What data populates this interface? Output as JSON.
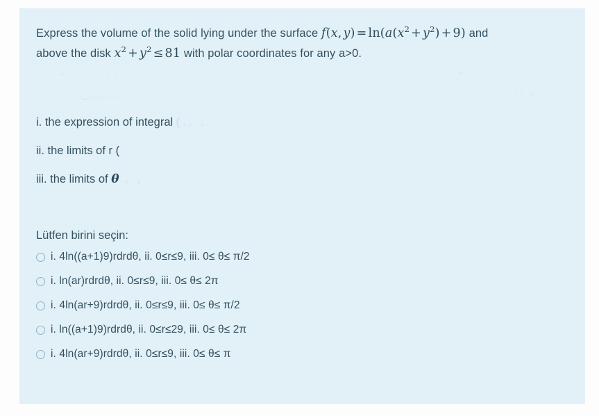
{
  "card": {
    "background_color": "#e2f0f8",
    "page_background_color": "#fdfdfd",
    "text_color": "#33515e"
  },
  "question": {
    "line1_prefix": "Express the volume of the solid lying under  the surface ",
    "formula_surface": "f(x, y) = ln(a(x² + y²) + 9)",
    "line1_suffix": " and",
    "line2_prefix": "above the disk ",
    "formula_disk": "x² + y² ≤ 81",
    "line2_suffix": " with  polar coordinates for any a>0."
  },
  "ghost_text": {
    "g1": ". - . . ..",
    "g2": ". .",
    "g3": "-_...... . ...",
    "g4": "- .",
    "g5": ".. ,"
  },
  "requirements": [
    {
      "label": "i. the expression of integral ",
      "trail": "(.. ."
    },
    {
      "label": "ii. the limits of r (",
      "trail": ""
    },
    {
      "label": "iii. the limits of ",
      "symbol": "θ",
      "trail": " .   ,"
    }
  ],
  "choose_prompt": "Lütfen birini seçin:",
  "options": [
    {
      "id": "a",
      "text": "i. 4ln((a+1)9)rdrdθ, ii. 0≤r≤9, iii. 0≤ θ≤ π/2",
      "selected": false
    },
    {
      "id": "b",
      "text": "i. ln(ar)rdrdθ, ii. 0≤r≤9, iii. 0≤ θ≤ 2π",
      "selected": false
    },
    {
      "id": "c",
      "text": "i. 4ln(ar+9)rdrdθ, ii. 0≤r≤9, iii. 0≤ θ≤ π/2",
      "selected": false
    },
    {
      "id": "d",
      "text": "i. ln((a+1)9)rdrdθ, ii. 0≤r≤29, iii. 0≤ θ≤ 2π",
      "selected": false
    },
    {
      "id": "e",
      "text": "i. 4ln(ar+9)rdrdθ, ii. 0≤r≤9, iii. 0≤ θ≤ π",
      "selected": false
    }
  ]
}
